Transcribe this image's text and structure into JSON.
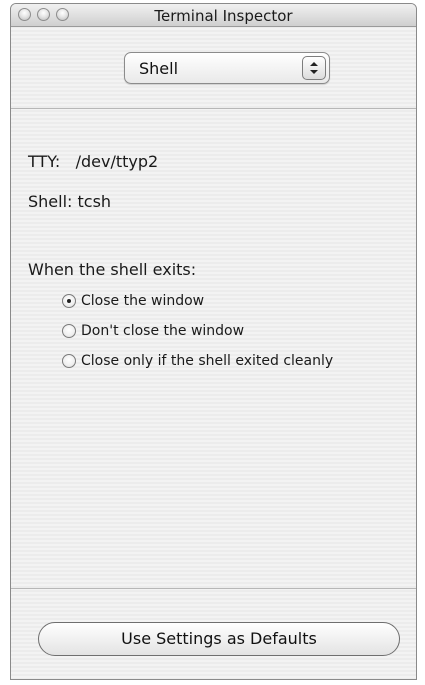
{
  "window": {
    "title": "Terminal Inspector"
  },
  "popup": {
    "selected": "Shell"
  },
  "info": {
    "tty_label": "TTY:",
    "tty_value": "/dev/ttyp2",
    "shell_label": "Shell:",
    "shell_value": "tcsh"
  },
  "exit_options": {
    "heading": "When the shell exits:",
    "options": [
      {
        "label": "Close the window",
        "selected": true
      },
      {
        "label": "Don't close the window",
        "selected": false
      },
      {
        "label": "Close only if the shell exited cleanly",
        "selected": false
      }
    ]
  },
  "footer": {
    "defaults_button": "Use Settings as Defaults"
  }
}
